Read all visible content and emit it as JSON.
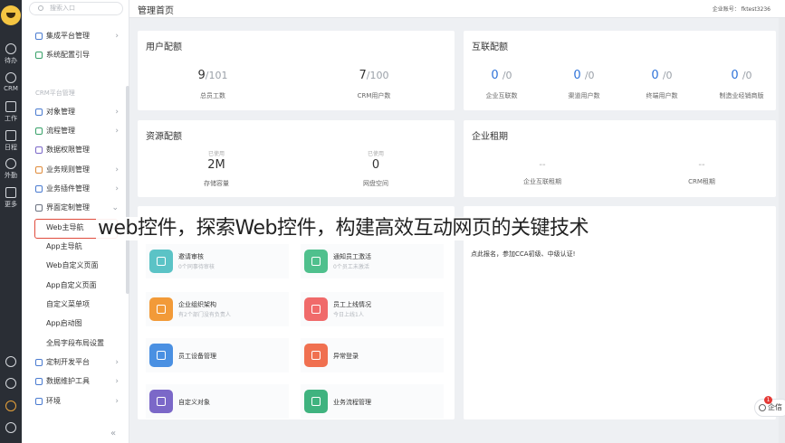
{
  "rail": {
    "items": [
      {
        "label": "待办",
        "icon": "check-circle-icon"
      },
      {
        "label": "CRM",
        "icon": "clock-icon"
      },
      {
        "label": "工作",
        "icon": "briefcase-icon"
      },
      {
        "label": "日程",
        "icon": "calendar-icon"
      },
      {
        "label": "外勤",
        "icon": "location-icon"
      },
      {
        "label": "更多",
        "icon": "grid-icon"
      }
    ]
  },
  "sidebar": {
    "search_placeholder": "搜索入口",
    "items_top": [
      {
        "label": "集成平台管理",
        "chevron": true
      },
      {
        "label": "系统配置引导",
        "chevron": false
      }
    ],
    "section": "CRM平台管理",
    "items": [
      {
        "label": "对象管理",
        "chevron": true
      },
      {
        "label": "流程管理",
        "chevron": true
      },
      {
        "label": "数据权限管理",
        "chevron": false
      },
      {
        "label": "业务规则管理",
        "chevron": true
      },
      {
        "label": "业务插件管理",
        "chevron": true
      },
      {
        "label": "界面定制管理",
        "chevron": true
      }
    ],
    "sub_items": [
      "Web主导航",
      "App主导航",
      "Web自定义页面",
      "App自定义页面",
      "自定义菜单项",
      "App启动图",
      "全局字段布局设置"
    ],
    "items_bottom": [
      {
        "label": "定制开发平台",
        "chevron": true
      },
      {
        "label": "数据维护工具",
        "chevron": true
      },
      {
        "label": "环境",
        "chevron": true
      }
    ],
    "collapse": "«"
  },
  "header": {
    "title": "管理首页",
    "account": "企业账号： fktest3236"
  },
  "quota_users": {
    "title": "用户配额",
    "stats": [
      {
        "value": "9",
        "total": "/101",
        "label": "总员工数"
      },
      {
        "value": "7",
        "total": "/100",
        "label": "CRM用户数"
      }
    ]
  },
  "quota_interconnect": {
    "title": "互联配额",
    "stats": [
      {
        "value": "0",
        "total": "/0",
        "label": "企业互联数"
      },
      {
        "value": "0",
        "total": "/0",
        "label": "渠道用户数"
      },
      {
        "value": "0",
        "total": "/0",
        "label": "终端用户数"
      },
      {
        "value": "0",
        "total": "/0",
        "label": "制造业经销商版"
      }
    ]
  },
  "quota_resources": {
    "title": "资源配额",
    "stats": [
      {
        "used": "已使用",
        "value": "2M",
        "label": "存储容量"
      },
      {
        "used": "已使用",
        "value": "0",
        "label": "网盘空间"
      }
    ]
  },
  "lease": {
    "title": "企业租期",
    "stats": [
      {
        "value": "--",
        "label": "企业互联租期"
      },
      {
        "value": "--",
        "label": "CRM租期"
      }
    ]
  },
  "tiles": [
    {
      "name": "邀请审核",
      "desc": "0个同事待审核",
      "color": "#5bc3c6"
    },
    {
      "name": "通知员工激活",
      "desc": "0个员工未激活",
      "color": "#4fc08d"
    },
    {
      "name": "企业组织架构",
      "desc": "有2个部门没有负责人",
      "color": "#f29a38"
    },
    {
      "name": "员工上线情况",
      "desc": "今日上线1人",
      "color": "#f06a6a"
    },
    {
      "name": "员工设备管理",
      "desc": "",
      "color": "#4a90e2"
    },
    {
      "name": "异常登录",
      "desc": "",
      "color": "#f07050"
    },
    {
      "name": "自定义对象",
      "desc": "",
      "color": "#7b68c8"
    },
    {
      "name": "业务流程管理",
      "desc": "",
      "color": "#3fb37f"
    }
  ],
  "notice": "点此报名，参加CCA初级、中级认证!",
  "caption": "web控件，探索Web控件，构建高效互动网页的关键技术",
  "chat": {
    "label": "企信",
    "badge": "1"
  }
}
